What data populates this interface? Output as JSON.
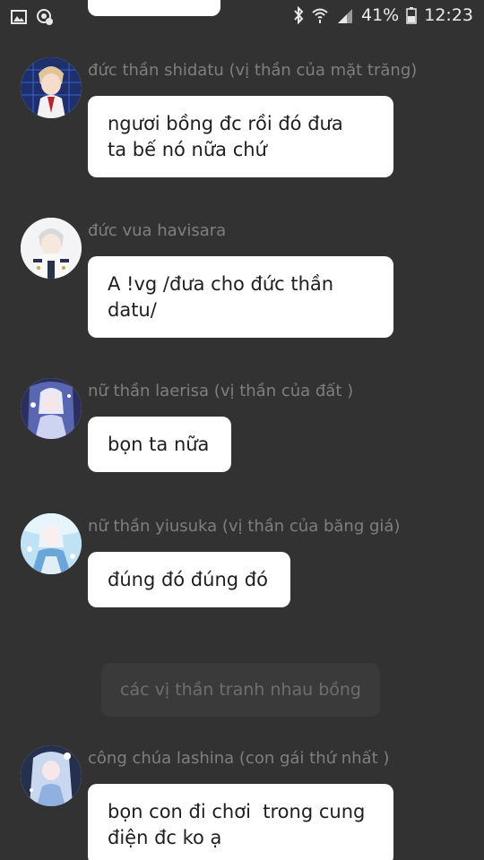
{
  "status_bar": {
    "battery_percent": "41%",
    "time": "12:23",
    "icons": [
      "gallery-icon",
      "vpn-icon",
      "bluetooth-icon",
      "wifi-icon",
      "signal-icon",
      "battery-icon"
    ]
  },
  "colors": {
    "background": "#323232",
    "bubble": "#ffffff",
    "sender_name": "#7f7f7f",
    "system_note_bg": "#3a3a3a"
  },
  "messages": [
    {
      "sender": "đức thần shidatu (vị thần của mặt trăng)",
      "text": "ngươi bồng đc rồi đó đưa\nta bế nó nữa chứ"
    },
    {
      "sender": "đức vua havisara",
      "text": "A !vg /đưa cho đức thần\ndatu/"
    },
    {
      "sender": "nữ thần laerisa (vị thần của đất )",
      "text": "bọn ta nữa"
    },
    {
      "sender": "nữ thần yiusuka (vị thần của băng giá)",
      "text": "đúng đó đúng đó"
    },
    {
      "sender": "công chúa lashina (con gái thứ nhất )",
      "text": "bọn con đi chơi  trong cung\nđiện đc ko ạ"
    }
  ],
  "system_note": "các vị thần tranh nhau bồng"
}
